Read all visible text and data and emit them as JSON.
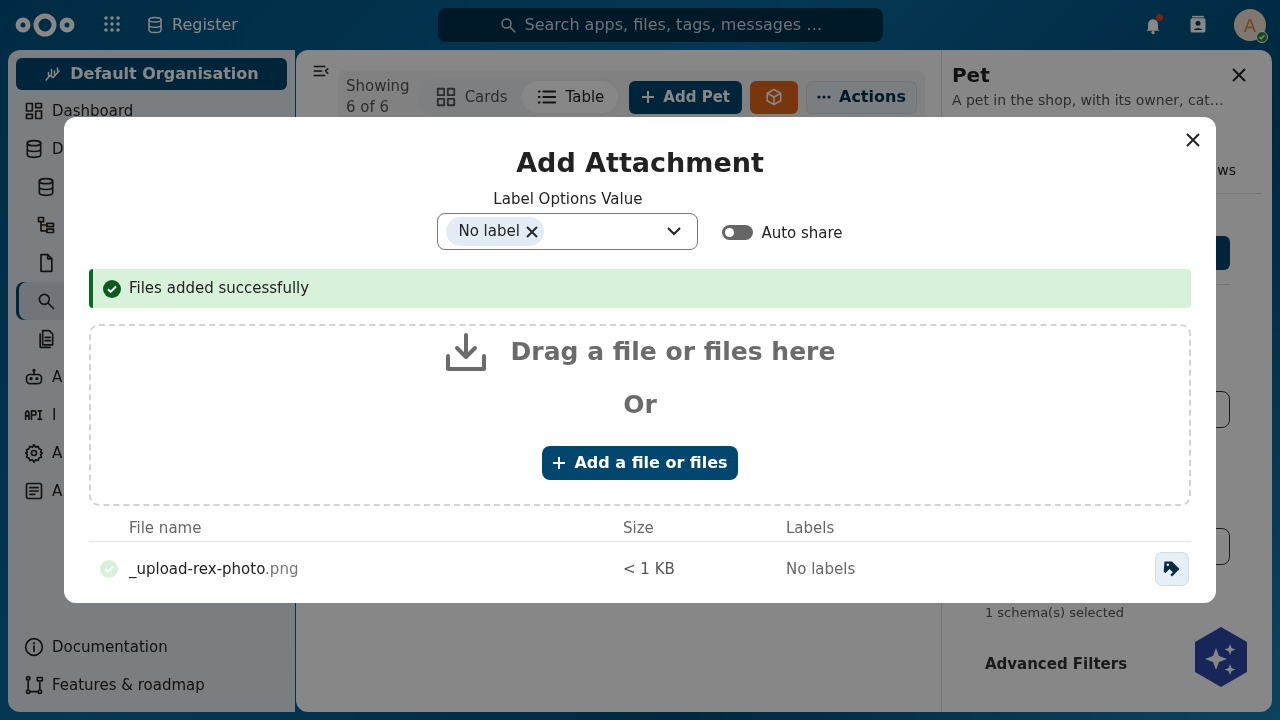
{
  "topbar": {
    "app_label": "Register",
    "search": {
      "placeholder": "Search apps, files, tags, messages …"
    },
    "notifications_unread": true,
    "avatar": {
      "initial": "A",
      "online": true
    }
  },
  "sidebar": {
    "organisation_button": "Default Organisation",
    "items": [
      {
        "label": "Dashboard",
        "selected": false
      },
      {
        "label": "D",
        "selected": false,
        "children": [
          {
            "selected": false
          },
          {
            "selected": false
          },
          {
            "selected": false
          },
          {
            "selected": true
          },
          {
            "selected": false
          }
        ]
      },
      {
        "label": "A",
        "selected": false
      },
      {
        "label": "I",
        "selected": false
      },
      {
        "label": "A",
        "selected": false
      },
      {
        "label": "A",
        "selected": false
      }
    ],
    "footer": [
      "Documentation",
      "Features & roadmap"
    ]
  },
  "main": {
    "showing": "Showing",
    "count": "6 of 6",
    "view_toggle": [
      {
        "label": "Cards",
        "selected": false
      },
      {
        "label": "Table",
        "selected": true
      }
    ],
    "add_button": "Add Pet",
    "actions_button": "Actions"
  },
  "side_panel": {
    "title": "Pet",
    "description": "A pet in the shop, with its owner, cat…",
    "tab_fragment": "ws",
    "schema_count": "1 schema(s) selected",
    "advanced_filters": "Advanced Filters"
  },
  "modal": {
    "title": "Add Attachment",
    "label_select": {
      "label": "Label Options Value",
      "chips": [
        "No label"
      ]
    },
    "auto_share": {
      "label": "Auto share",
      "on": false
    },
    "alert": {
      "text": "Files added successfully"
    },
    "dropzone": {
      "headline": "Drag a file or files here",
      "separator": "Or",
      "button": "Add a file or files"
    },
    "table": {
      "columns": [
        "File name",
        "Size",
        "Labels"
      ],
      "rows": [
        {
          "name": "_upload-rex-photo",
          "extension": ".png",
          "size": "< 1 KB",
          "labels": "No labels",
          "uploaded": true
        }
      ]
    }
  }
}
